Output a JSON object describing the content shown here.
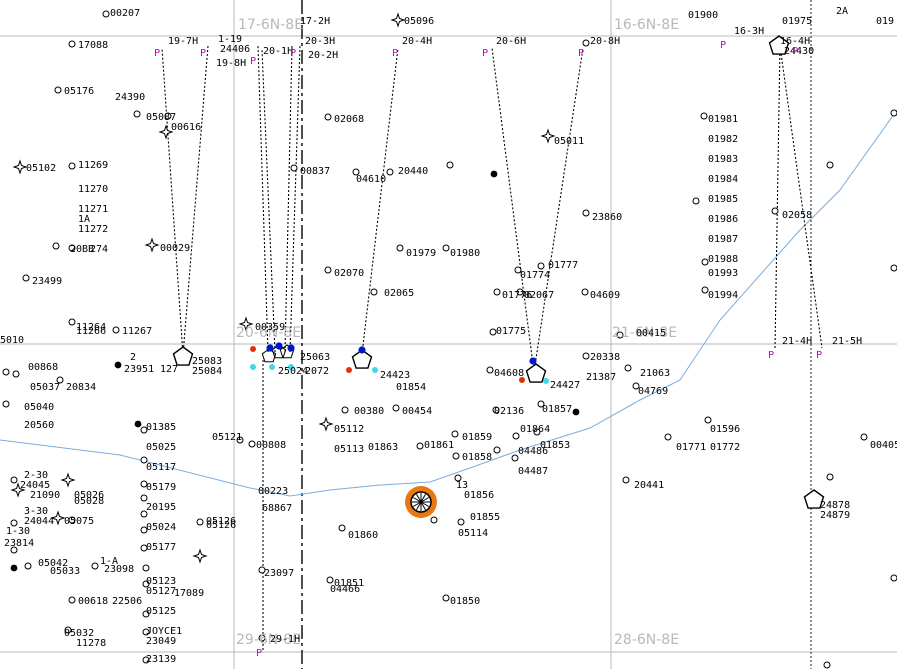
{
  "sections": [
    {
      "id": "sec-17",
      "label": "17-6N-8E"
    },
    {
      "id": "sec-16",
      "label": "16-6N-8E"
    },
    {
      "id": "sec-20",
      "label": "20-6N-8E"
    },
    {
      "id": "sec-21",
      "label": "21-6N-8E"
    },
    {
      "id": "sec-29",
      "label": "29-6N-8E"
    },
    {
      "id": "sec-28",
      "label": "28-6N-8E"
    }
  ],
  "well_labels": [
    "00207",
    "17088",
    "05176",
    "24390",
    "05087",
    "00616",
    "05102",
    "11269",
    "11270",
    "11271",
    "1A",
    "11272",
    "20BB",
    "274",
    "00029",
    "23499",
    "11264",
    "11266",
    "11267",
    "5010",
    "00868",
    "05037",
    "20834",
    "05040",
    "20560",
    "2",
    "23951",
    "127",
    "25083",
    "25084",
    "00359",
    "25063",
    "25024",
    "2072",
    "02068",
    "00837",
    "04610",
    "20440",
    "02070",
    "02065",
    "01979",
    "01980",
    "24423",
    "01854",
    "00380",
    "00454",
    "05112",
    "05113",
    "01863",
    "01861",
    "01858",
    "01859",
    "01860",
    "01856",
    "01855",
    "05114",
    "01851",
    "04466",
    "01850",
    "23097",
    "00808",
    "00223",
    "68867",
    "29-1H",
    "05096",
    "20-4H",
    "20-6H",
    "20-8H",
    "16-3H",
    "16-4H",
    "24430",
    "17-2H",
    "20-2H",
    "20-1H",
    "20-3H",
    "19-7H",
    "1-19",
    "24406",
    "19-8H",
    "05011",
    "23860",
    "01777",
    "01774",
    "01776",
    "02067",
    "04609",
    "01775",
    "04608",
    "24427",
    "02136",
    "01864",
    "01853",
    "04486",
    "04487",
    "01857",
    "00415",
    "20338",
    "21387",
    "21063",
    "04769",
    "01771",
    "01772",
    "01596",
    "20441",
    "24878",
    "24879",
    "00405",
    "21-4H",
    "21-5H",
    "01981",
    "01982",
    "01983",
    "01984",
    "01985",
    "01986",
    "01987",
    "01988",
    "01993",
    "01994",
    "02058",
    "01975",
    "01900",
    "019",
    "2A",
    "01385",
    "05025",
    "05117",
    "05179",
    "20195",
    "05024",
    "05177",
    "05126",
    "05123",
    "05125",
    "05121",
    "17089",
    "23098",
    "00618",
    "22506",
    "05033",
    "23814",
    "05042",
    "JOYCE1",
    "23049",
    "23139",
    "11278",
    "05032",
    "24045",
    "21090",
    "24044",
    "05075",
    "05026",
    "05028",
    "05127",
    "05126",
    "2-30",
    "3-30",
    "1-30",
    "1-A",
    "13"
  ],
  "magnetic_marker": "P",
  "colors": {
    "section_line": "#b8b8b8",
    "creek": "#7aaee0",
    "pad_fill": "#ffffff",
    "highlight": "#e87812",
    "blue_dot": "#0018c8",
    "red_dot": "#e03010",
    "cyan_dot": "#40d8e8",
    "mag": "#cc00cc"
  }
}
